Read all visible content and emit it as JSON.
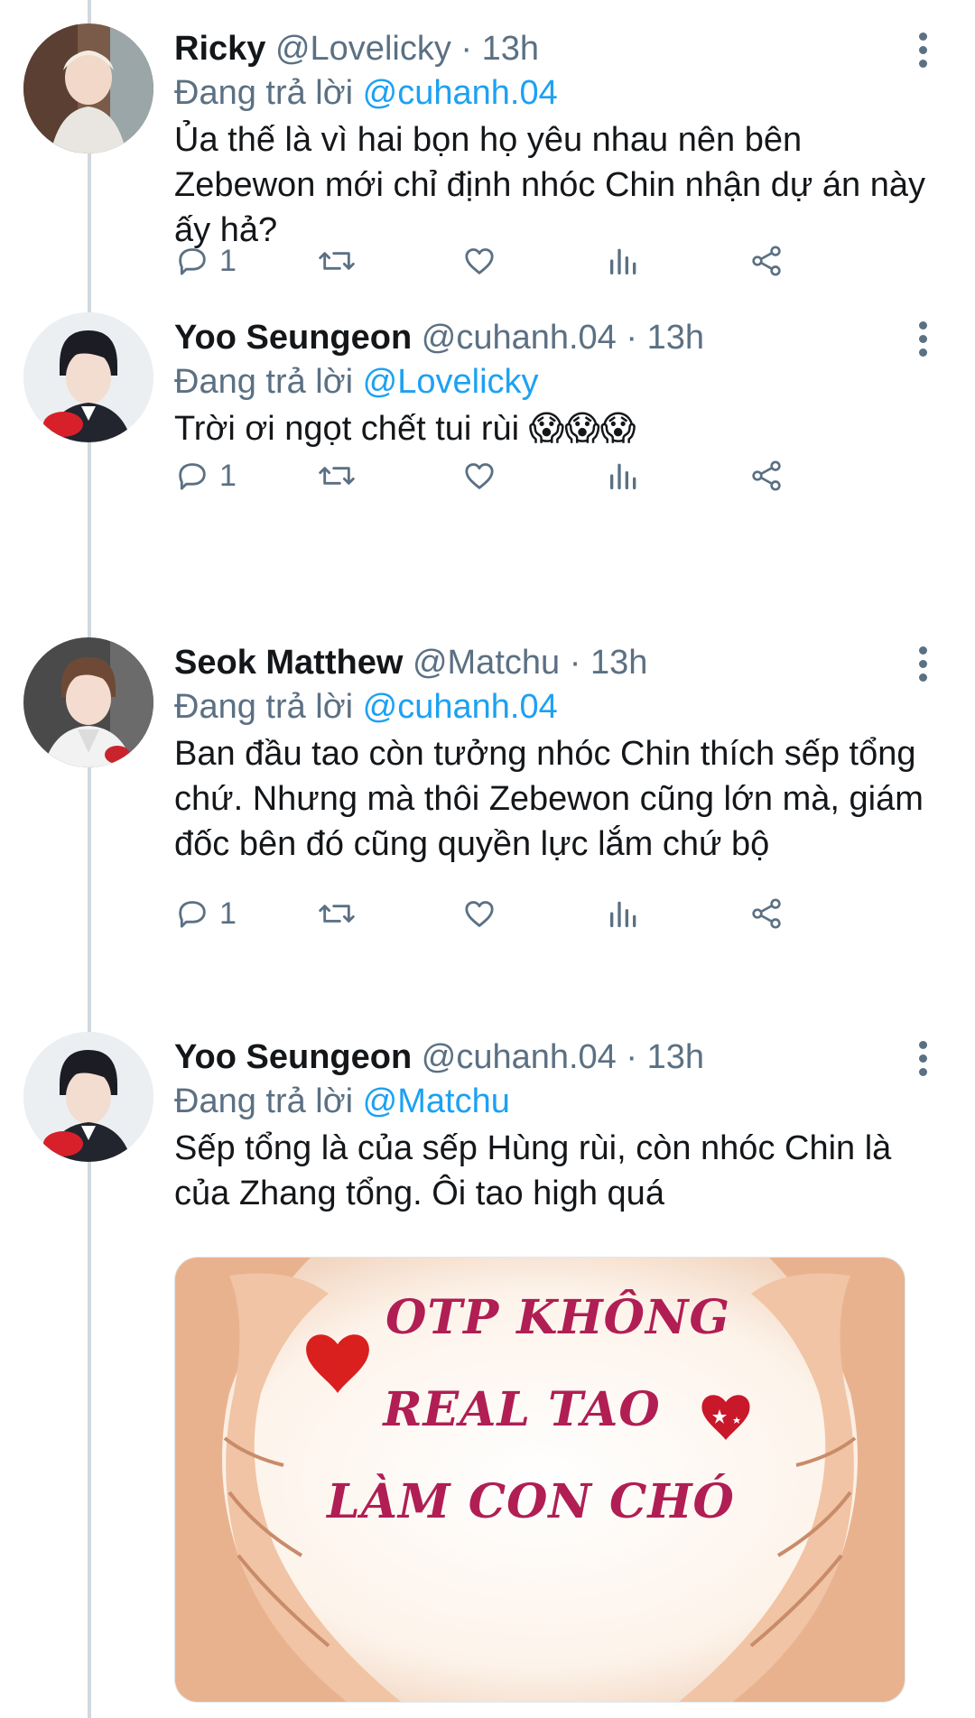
{
  "reply_prefix": "Đang trả lời",
  "separator": "·",
  "colors": {
    "text": "#14171a",
    "secondary": "#5b7083",
    "link": "#1da1f2",
    "thread_line": "#cfd9de",
    "meme_text": "#b01e54"
  },
  "icons": [
    "reply-icon",
    "retweet-icon",
    "like-icon",
    "analytics-icon",
    "share-icon",
    "more-icon"
  ],
  "tweets": [
    {
      "name": "Ricky",
      "handle": "@Lovelicky",
      "time": "13h",
      "reply_to": "@cuhanh.04",
      "text": "Ủa thế là vì hai bọn họ yêu nhau nên bên Zebewon mới chỉ định nhóc Chin nhận dự án này ấy hả?",
      "reply_count": "1"
    },
    {
      "name": "Yoo Seungeon",
      "handle": "@cuhanh.04",
      "time": "13h",
      "reply_to": "@Lovelicky",
      "text": "Trời ơi ngọt chết tui rùi 😱😱😱",
      "reply_count": "1"
    },
    {
      "name": "Seok Matthew",
      "handle": "@Matchu",
      "time": "13h",
      "reply_to": "@cuhanh.04",
      "text": "Ban đầu tao còn tưởng nhóc Chin thích sếp tổng chứ. Nhưng mà thôi Zebewon cũng lớn mà, giám đốc bên đó cũng quyền lực lắm chứ bộ",
      "reply_count": "1"
    },
    {
      "name": "Yoo Seungeon",
      "handle": "@cuhanh.04",
      "time": "13h",
      "reply_to": "@Matchu",
      "text": "Sếp tổng là của sếp Hùng rùi, còn nhóc Chin là của Zhang tổng. Ôi tao high quá",
      "reply_count": ""
    }
  ],
  "media": {
    "line1": "OTP KHÔNG",
    "line2": "REAL TAO",
    "line3": "LÀM CON CHÓ"
  }
}
